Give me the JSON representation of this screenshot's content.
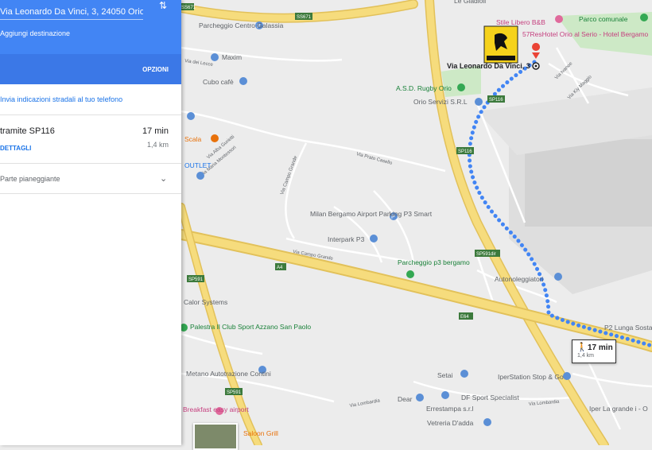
{
  "panel": {
    "destination": "Via Leonardo Da Vinci, 3, 24050 Orio al Serio",
    "add_destination": "Aggiungi destinazione",
    "options": "OPZIONI",
    "send_to_phone": "Invia indicazioni stradali al tuo telefono",
    "route": {
      "name": "tramite SP116",
      "time": "17 min",
      "distance": "1,4 km",
      "details": "DETTAGLI"
    },
    "depart": "Parte pianeggiante"
  },
  "walk_badge": {
    "time": "17 min",
    "distance": "1,4 km",
    "icon": "walking-person-icon"
  },
  "map": {
    "colors": {
      "background": "#ececec",
      "highway": "#f6dc7d",
      "highway_border": "#e2c15a",
      "road": "#ffffff",
      "route": "#4285f4",
      "park": "#cde9c6",
      "airport": "#dcdcdc",
      "poi_blue": "#5b8fd6",
      "poi_green": "#34a853",
      "poi_pink": "#e06a9c",
      "pin": "#ea4335"
    },
    "road_labels": [
      "SS671",
      "SS671",
      "SP116",
      "SP116",
      "SP591dir",
      "A4",
      "SP591",
      "SP591",
      "E64"
    ],
    "street_labels": [
      "Via dei Lecce",
      "Via Prato Casello",
      "Via Alba Gurietti",
      "Via Maria Montessori",
      "Via Campo Grande",
      "Via Campo Grande",
      "Via Ivanoe",
      "Via Lombardia",
      "Via Kiy Maggio",
      "Via Lombardia"
    ],
    "places": [
      {
        "name": "Parcheggio Centro Galassia",
        "color": "#5f6368",
        "icon": "parking-icon"
      },
      {
        "name": "Maxim",
        "color": "#5f6368",
        "icon": "shop-icon"
      },
      {
        "name": "Cubo cafè",
        "color": "#5f6368",
        "icon": "cafe-icon"
      },
      {
        "name": "Scala",
        "color": "#e8710a",
        "icon": "restaurant-icon"
      },
      {
        "name": "OUTLET",
        "color": "#1a73e8",
        "icon": "shop-icon"
      },
      {
        "name": "Milan Bergamo Airport Parking P3 Smart",
        "color": "#5f6368",
        "icon": "parking-icon"
      },
      {
        "name": "Interpark P3",
        "color": "#5f6368",
        "icon": "parking-icon"
      },
      {
        "name": "Parcheggio p3 bergamo",
        "color": "#188038",
        "icon": "parking-icon"
      },
      {
        "name": "A.S.D. Rugby Orio",
        "color": "#188038",
        "icon": "sports-icon"
      },
      {
        "name": "Orio Servizi S.R.L",
        "color": "#5f6368",
        "icon": "business-icon"
      },
      {
        "name": "Stile Libero B&B",
        "color": "#c5407f",
        "icon": "hotel-icon"
      },
      {
        "name": "57ResHotel Orio al Serio - Hotel Bergamo",
        "color": "#c5407f",
        "icon": "hotel-icon"
      },
      {
        "name": "Parco comunale",
        "color": "#188038",
        "icon": "park-icon"
      },
      {
        "name": "Via Leonardo Da Vinci, 3",
        "color": "#202124",
        "icon": "destination-icon"
      },
      {
        "name": "Autonoleggiatori",
        "color": "#5f6368",
        "icon": "car-rental-icon"
      },
      {
        "name": "P2 Lunga Sosta",
        "color": "#5f6368",
        "icon": "parking-icon"
      },
      {
        "name": "Calor Systems",
        "color": "#5f6368",
        "icon": "business-icon"
      },
      {
        "name": "Palestra Il Club Sport Azzano San Paolo",
        "color": "#188038",
        "icon": "gym-icon"
      },
      {
        "name": "Metano Autotrazione Contini",
        "color": "#5f6368",
        "icon": "gas-icon"
      },
      {
        "name": "Setai",
        "color": "#5f6368",
        "icon": "shop-icon"
      },
      {
        "name": "IperStation Stop & Go",
        "color": "#5f6368",
        "icon": "gas-icon"
      },
      {
        "name": "Dear",
        "color": "#5f6368",
        "icon": "shop-icon"
      },
      {
        "name": "DF Sport Specialist",
        "color": "#5f6368",
        "icon": "shop-icon"
      },
      {
        "name": "Errestampa s.r.l",
        "color": "#5f6368",
        "icon": "business-icon"
      },
      {
        "name": "Vetreria D'adda",
        "color": "#5f6368",
        "icon": "business-icon"
      },
      {
        "name": "Iper La grande i - O",
        "color": "#5f6368",
        "icon": "shop-icon"
      },
      {
        "name": "Breakfast easy airport",
        "color": "#c5407f",
        "icon": "hotel-icon"
      },
      {
        "name": "Saloon Grill",
        "color": "#e8710a",
        "icon": "restaurant-icon"
      },
      {
        "name": "Le Gladioli",
        "color": "#5f6368",
        "icon": "business-icon"
      }
    ]
  }
}
